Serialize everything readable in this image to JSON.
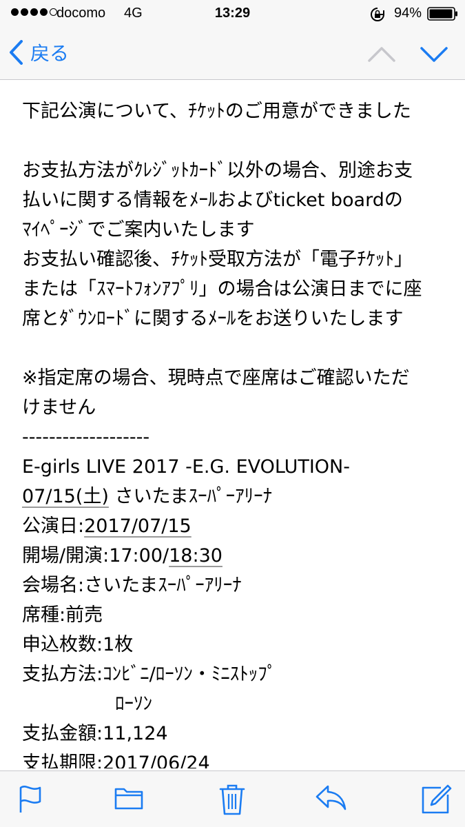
{
  "status_bar": {
    "carrier": "docomo",
    "network": "4G",
    "time": "13:29",
    "battery": "94%"
  },
  "nav": {
    "back_label": "戻る"
  },
  "email": {
    "line1": "下記公演について、ﾁｹｯﾄのご用意ができました",
    "line2": "お支払方法がｸﾚｼﾞｯﾄｶｰﾄﾞ以外の場合、別途お支",
    "line3": "払いに関する情報をﾒｰﾙおよびticket boardの",
    "line4": "ﾏｲﾍﾟｰｼﾞでご案内いたします",
    "line5": "お支払い確認後、ﾁｹｯﾄ受取方法が「電子ﾁｹｯﾄ」",
    "line6": "または「ｽﾏｰﾄﾌｫﾝｱﾌﾟﾘ」の場合は公演日までに座",
    "line7": "席とﾀﾞｳﾝﾛｰﾄﾞに関するﾒｰﾙをお送りいたします",
    "line8": "※指定席の場合、現時点で座席はご確認いただ",
    "line9": "けません",
    "separator": "-------------------",
    "event_title": "E-girls LIVE 2017 -E.G. EVOLUTION-",
    "event_date_link": "07/15(土)",
    "event_venue_short": " さいたまｽｰﾊﾟｰｱﾘｰﾅ",
    "show_date_label": "公演日:",
    "show_date_value": "2017/07/15",
    "open_start_label": "開場/開演:17:00/",
    "open_start_link": "18:30",
    "venue_line": "会場名:さいたまｽｰﾊﾟｰｱﾘｰﾅ",
    "seat_type_line": "席種:前売",
    "quantity_line": "申込枚数:1枚",
    "payment_method_line": "支払方法:ｺﾝﾋﾞﾆ/ﾛｰｿﾝ・ﾐﾆｽﾄｯﾌﾟ",
    "payment_method_cont": "ﾛｰｿﾝ",
    "amount_line": "支払金額:11,124",
    "deadline_label": "支払期限:",
    "deadline_value": "2017/06/24"
  },
  "toolbar": {
    "items": [
      "flag-icon",
      "folder-icon",
      "trash-icon",
      "reply-icon",
      "compose-icon"
    ]
  },
  "colors": {
    "accent": "#1b7cf2",
    "bar_background": "#f7f7f7",
    "disabled": "#c7c7cc"
  }
}
